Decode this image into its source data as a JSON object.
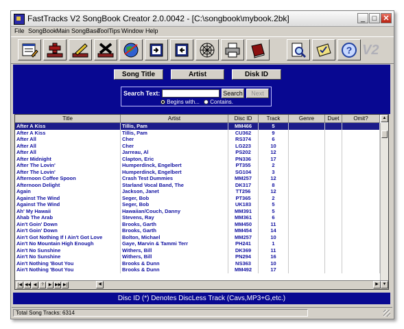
{
  "window": {
    "title": "FastTracks V2 SongBook Creator 2.0.0042 - [C:\\songbook\\mybook.2bk]",
    "controls": {
      "minimize": "_",
      "maximize": "□",
      "close": "✕"
    }
  },
  "menu": [
    "File",
    "SongBook",
    "Main SongBase",
    "ToolTips",
    "Window",
    "Help"
  ],
  "toolbar": {
    "icons": [
      "edit-form-icon",
      "add-song-icon",
      "edit-song-icon",
      "delete-song-icon",
      "globe-icon",
      "import-book-icon",
      "export-book-icon",
      "web-icon",
      "printer-icon",
      "book-icon",
      "preview-icon",
      "checklist-icon",
      "help-icon"
    ],
    "logo": "V2"
  },
  "search": {
    "modes": [
      "Song Title",
      "Artist",
      "Disk ID"
    ],
    "label": "Search Text:",
    "value": "",
    "search_button": "Search",
    "next_button": "Next",
    "option_begins": "Begins with...",
    "option_contains": "Contains."
  },
  "table": {
    "columns": [
      "Title",
      "Artist",
      "Disc ID",
      "Track",
      "Genre",
      "Duet",
      "Omit?"
    ],
    "rows": [
      [
        "After A Kiss",
        "Tillis, Pam",
        "MM466",
        "5",
        "",
        "",
        ""
      ],
      [
        "After A Kiss",
        "Tillis, Pam",
        "CU362",
        "9",
        "",
        "",
        ""
      ],
      [
        "After All",
        "Cher",
        "RS374",
        "6",
        "",
        "",
        ""
      ],
      [
        "After All",
        "Cher",
        "LG223",
        "10",
        "",
        "",
        ""
      ],
      [
        "After All",
        "Jarreau, Al",
        "PS202",
        "12",
        "",
        "",
        ""
      ],
      [
        "After Midnight",
        "Clapton, Eric",
        "PN336",
        "17",
        "",
        "",
        ""
      ],
      [
        "After The Lovin'",
        "Humperdinck, Engelbert",
        "PT355",
        "2",
        "",
        "",
        ""
      ],
      [
        "After The Lovin'",
        "Humperdinck, Engelbert",
        "SG104",
        "3",
        "",
        "",
        ""
      ],
      [
        "Afternoon Coffee Spoon",
        "Crash Test Dummies",
        "MM257",
        "12",
        "",
        "",
        ""
      ],
      [
        "Afternoon Delight",
        "Starland Vocal Band, The",
        "DK317",
        "8",
        "",
        "",
        ""
      ],
      [
        "Again",
        "Jackson, Janet",
        "TT256",
        "12",
        "",
        "",
        ""
      ],
      [
        "Against The Wind",
        "Seger, Bob",
        "PT365",
        "2",
        "",
        "",
        ""
      ],
      [
        "Against The Wind",
        "Seger, Bob",
        "UK183",
        "5",
        "",
        "",
        ""
      ],
      [
        "Ah' My Hawaii",
        "Hawaiian/Couch, Danny",
        "MM391",
        "5",
        "",
        "",
        ""
      ],
      [
        "Ahab The Arab",
        "Stevens, Ray",
        "MM361",
        "6",
        "",
        "",
        ""
      ],
      [
        "Ain't Goin' Down",
        "Brooks, Garth",
        "MM450",
        "11",
        "",
        "",
        ""
      ],
      [
        "Ain't Goin' Down",
        "Brooks, Garth",
        "MM454",
        "14",
        "",
        "",
        ""
      ],
      [
        "Ain't Got Nothing If I Ain't Got Love",
        "Bolton, Michael",
        "MM257",
        "10",
        "",
        "",
        ""
      ],
      [
        "Ain't No Mountain High Enough",
        "Gaye, Marvin & Tammi Terr",
        "PH241",
        "1",
        "",
        "",
        ""
      ],
      [
        "Ain't No Sunshine",
        "Withers, Bill",
        "DK369",
        "11",
        "",
        "",
        ""
      ],
      [
        "Ain't No Sunshine",
        "Withers, Bill",
        "PN294",
        "16",
        "",
        "",
        ""
      ],
      [
        "Ain't Nothing 'Bout You",
        "Brooks & Dunn",
        "NS363",
        "10",
        "",
        "",
        ""
      ],
      [
        "Ain't Nothing 'Bout You",
        "Brooks & Dunn",
        "MM492",
        "17",
        "",
        "",
        ""
      ]
    ]
  },
  "navigator": [
    "|◀",
    "◀◀",
    "◀",
    "?",
    "▶",
    "▶▶",
    "▶|"
  ],
  "footer_note": "Disc ID (*) Denotes DiscLess Track (Cavs,MP3+G,etc.)",
  "status": "Total Song Tracks: 6314"
}
